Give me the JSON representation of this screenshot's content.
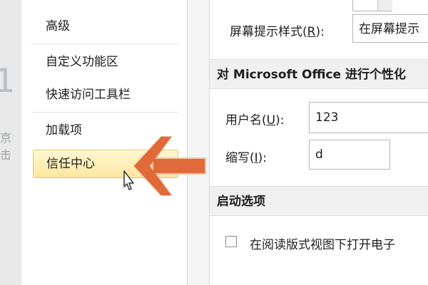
{
  "background": {
    "glyph_1": "1",
    "glyph_2": "京击"
  },
  "nav": {
    "items": [
      {
        "label": "高级"
      },
      {
        "label": "自定义功能区"
      },
      {
        "label": "快速访问工具栏"
      },
      {
        "label": "加载项"
      },
      {
        "label": "信任中心",
        "selected": true
      }
    ]
  },
  "content": {
    "screentip_label": "屏幕提示样式(",
    "screentip_key": "R",
    "screentip_suffix": "):",
    "screentip_value": "在屏幕提示",
    "section_personalize": "对 Microsoft Office 进行个性化",
    "username_label": "用户名(",
    "username_key": "U",
    "username_suffix": "):",
    "username_value": "123",
    "initials_label": "缩写(",
    "initials_key": "I",
    "initials_suffix": "):",
    "initials_value": "d",
    "section_startup": "启动选项",
    "reading_view_label": "在阅读版式视图下打开电子",
    "reading_view_checked": false
  },
  "colors": {
    "selected_fill": "#fde69f",
    "selected_border": "#eac46a",
    "arrow": "#e06a3a"
  },
  "icons": [
    "arrow-left-icon",
    "mouse-pointer-icon",
    "dropdown-arrow-icon"
  ]
}
